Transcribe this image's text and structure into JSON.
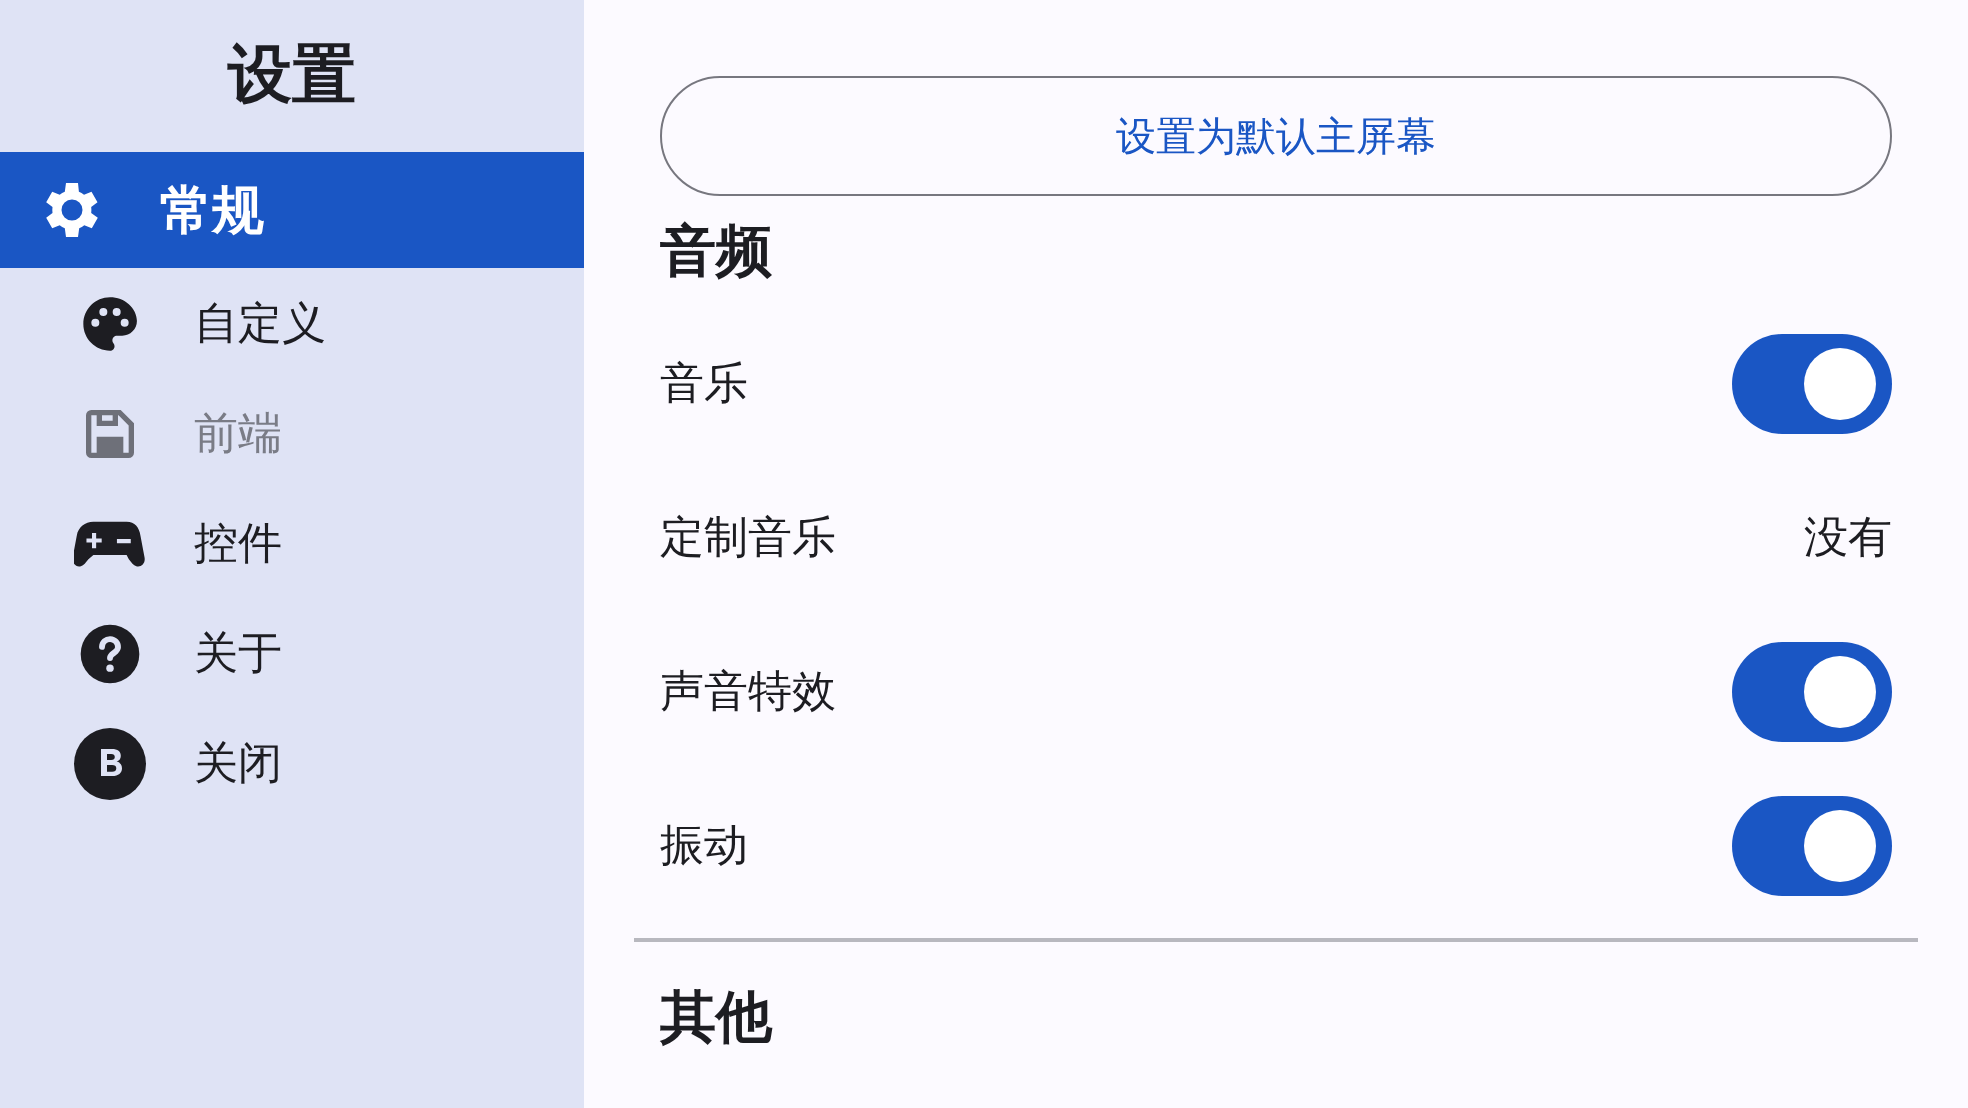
{
  "sidebar": {
    "title": "设置",
    "items": [
      {
        "label": "常规",
        "selected": true,
        "disabled": false
      },
      {
        "label": "自定义",
        "selected": false,
        "disabled": false
      },
      {
        "label": "前端",
        "selected": false,
        "disabled": true
      },
      {
        "label": "控件",
        "selected": false,
        "disabled": false
      },
      {
        "label": "关于",
        "selected": false,
        "disabled": false
      },
      {
        "label": "关闭",
        "selected": false,
        "disabled": false
      }
    ]
  },
  "main": {
    "default_button": "设置为默认主屏幕",
    "sections": [
      {
        "title": "音频",
        "rows": [
          {
            "kind": "toggle",
            "label": "音乐",
            "on": true
          },
          {
            "kind": "value",
            "label": "定制音乐",
            "value": "没有"
          },
          {
            "kind": "toggle",
            "label": "声音特效",
            "on": true
          },
          {
            "kind": "toggle",
            "label": "振动",
            "on": true
          }
        ]
      },
      {
        "title": "其他"
      }
    ]
  }
}
